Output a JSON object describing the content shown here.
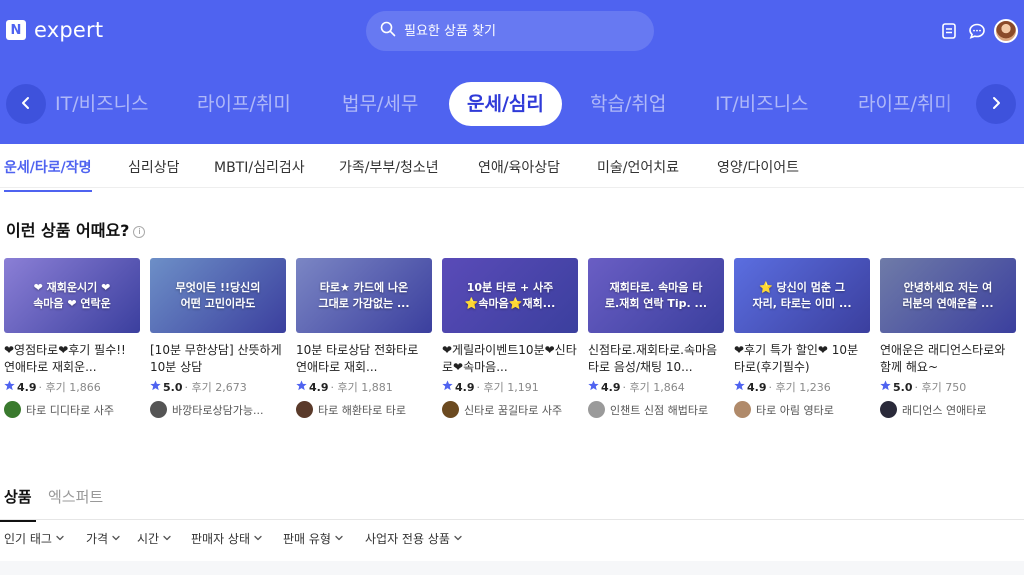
{
  "header": {
    "logo_letter": "N",
    "logo_text": "expert",
    "search_placeholder": "필요한 상품 찾기",
    "icons": [
      "document-icon",
      "chat-icon",
      "avatar"
    ]
  },
  "categories": [
    "IT/비즈니스",
    "라이프/취미",
    "법무/세무",
    "운세/심리",
    "학습/취업",
    "IT/비즈니스",
    "라이프/취미"
  ],
  "active_category": "운세/심리",
  "subcategories": [
    "운세/타로/작명",
    "심리상담",
    "MBTI/심리검사",
    "가족/부부/청소년",
    "연애/육아상담",
    "미술/언어치료",
    "영양/다이어트"
  ],
  "section": {
    "title": "이런 상품 어때요?",
    "info": "i"
  },
  "cards": [
    {
      "thumb": "❤ 재회운시기 ❤\n속마음 ❤ 연락운",
      "title": "❤영점타로❤후기 필수!! 연애타로 재회운...",
      "score": "4.9",
      "reviews": "· 후기 1,866",
      "seller": "타로 디디타로 사주",
      "thumb_color": "#8b7fd6",
      "avatar_color": "#3a7a2e"
    },
    {
      "thumb": "무엇이든 !!당신의\n어떤 고민이라도",
      "title": "[10분 무한상담] 산뜻하게 10분 상담",
      "score": "5.0",
      "reviews": "· 후기 2,673",
      "seller": "바깡타로상담가능...",
      "thumb_color": "#6d8fc7",
      "avatar_color": "#555"
    },
    {
      "thumb": "타로★ 카드에 나온\n그대로 가감없는 ...",
      "title": "10분 타로상담 전화타로 연애타로 재회...",
      "score": "4.9",
      "reviews": "· 후기 1,881",
      "seller": "타로 해환타로 타로",
      "thumb_color": "#7b86c4",
      "avatar_color": "#5a3a2a"
    },
    {
      "thumb": "10분 타로 + 사주\n⭐속마음⭐재회...",
      "title": "❤게릴라이벤트10분❤신타로❤속마음...",
      "score": "4.9",
      "reviews": "· 후기 1,191",
      "seller": "신타로 꿈길타로 사주",
      "thumb_color": "#5a4bb8",
      "avatar_color": "#6b4a20"
    },
    {
      "thumb": "재회타로. 속마음 타\n로.재회 연락 Tip. ...",
      "title": "신점타로.재회타로.속마음타로 음성/채팅 10...",
      "score": "4.9",
      "reviews": "· 후기 1,864",
      "seller": "인챈트 신점 해법타로",
      "thumb_color": "#6a5ec4",
      "avatar_color": "#9a9a9a"
    },
    {
      "thumb": "⭐ 당신이 멈춘 그\n자리, 타로는 이미 ...",
      "title": "❤후기 특가 할인❤ 10분 타로(후기필수)",
      "score": "4.9",
      "reviews": "· 후기 1,236",
      "seller": "타로 아림 영타로",
      "thumb_color": "#5b6ee0",
      "avatar_color": "#b08a6a"
    },
    {
      "thumb": "안녕하세요  저는 여\n러분의 연애운을 ...",
      "title": "연애운은 래디언스타로와 함께 해요~",
      "score": "5.0",
      "reviews": "· 후기 750",
      "seller": "래디언스 연애타로",
      "thumb_color": "#6f7ba8",
      "avatar_color": "#2a2a3a"
    }
  ],
  "bottom_tabs": [
    "상품",
    "엑스퍼트"
  ],
  "active_bottom_tab": "상품",
  "filters": [
    "인기 태그",
    "가격",
    "시간",
    "판매자 상태",
    "판매 유형",
    "사업자 전용 상품"
  ],
  "colors": {
    "brand": "#4f63f0",
    "active_category_text": "#2f3ad8",
    "star": "#4f63f0"
  }
}
